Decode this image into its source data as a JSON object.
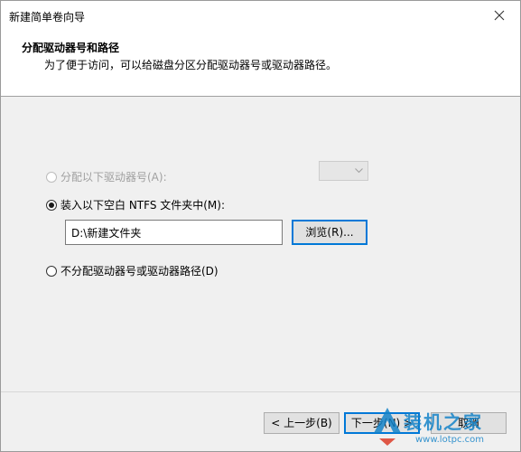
{
  "window": {
    "title": "新建简单卷向导"
  },
  "header": {
    "title": "分配驱动器号和路径",
    "subtitle": "为了便于访问，可以给磁盘分区分配驱动器号或驱动器路径。"
  },
  "options": {
    "assign_letter": {
      "label": "分配以下驱动器号(A):",
      "selected": false,
      "enabled": false,
      "drive_letter_value": ""
    },
    "mount_folder": {
      "label": "装入以下空白 NTFS 文件夹中(M):",
      "selected": true,
      "enabled": true,
      "path_value": "D:\\新建文件夹",
      "browse_label": "浏览(R)..."
    },
    "no_assign": {
      "label": "不分配驱动器号或驱动器路径(D)",
      "selected": false,
      "enabled": true
    }
  },
  "footer": {
    "back_label": "< 上一步(B)",
    "next_label": "下一步(N) >",
    "cancel_label": "取消"
  },
  "watermark": {
    "text": "装机之家",
    "url": "www.lotpc.com"
  },
  "colors": {
    "focus_border": "#0078d7",
    "window_bg": "#f0f0f0",
    "header_bg": "#ffffff",
    "button_bg": "#e1e1e1",
    "watermark": "#1482c8"
  }
}
